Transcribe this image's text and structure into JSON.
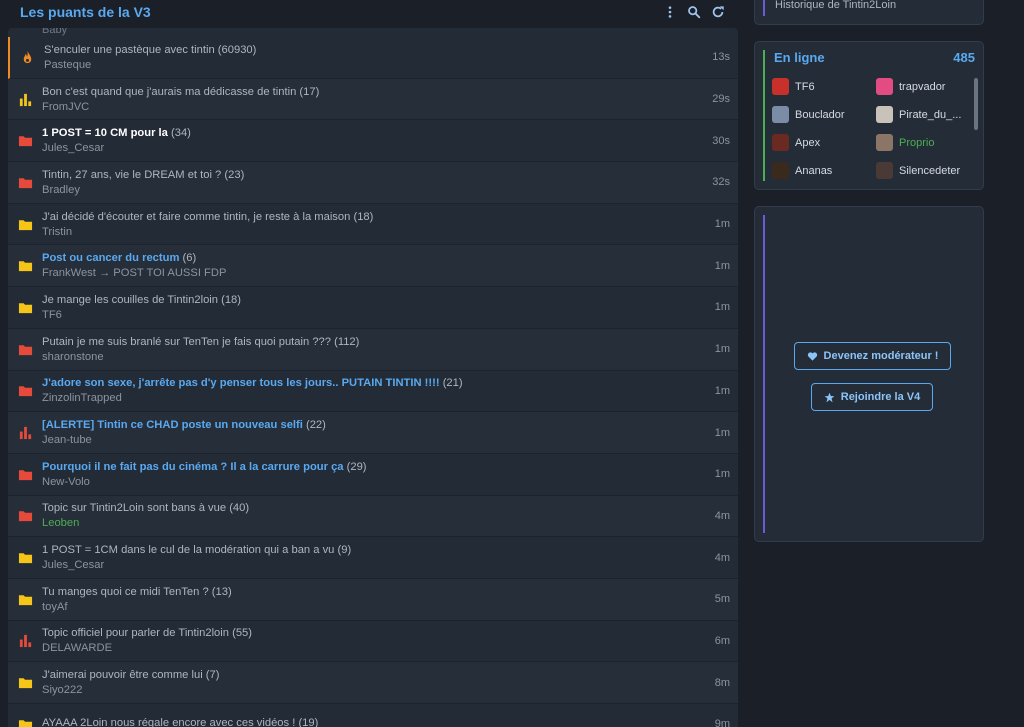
{
  "header": {
    "title": "Les puants de la V3"
  },
  "peek_text": "Baby",
  "topics": [
    {
      "icon": "fire",
      "color": "#f08a24",
      "title": "S'enculer une pastèque avec tintin",
      "count": "(60930)",
      "author": "Pasteque",
      "time": "13s",
      "style": "",
      "hot": true
    },
    {
      "icon": "chart",
      "color": "#f5c518",
      "title": "Bon c'est quand que j'aurais ma dédicasse de tintin",
      "count": "(17)",
      "author": "FromJVC",
      "time": "29s",
      "style": ""
    },
    {
      "icon": "folder",
      "color": "#e64a3b",
      "title": "1 POST = 10 CM pour la ",
      "count": "(34)",
      "author": "Jules_Cesar",
      "time": "30s",
      "style": "white"
    },
    {
      "icon": "folder",
      "color": "#e64a3b",
      "title": "Tintin, 27 ans, vie le DREAM et toi ?",
      "count": "(23)",
      "author": "Bradley",
      "time": "32s",
      "style": ""
    },
    {
      "icon": "folder",
      "color": "#f5c518",
      "title": "J'ai décidé d'écouter et faire comme tintin, je reste à la maison",
      "count": "(18)",
      "author": "Tristin",
      "time": "1m",
      "style": ""
    },
    {
      "icon": "folder",
      "color": "#f5c518",
      "title": "Post ou cancer du rectum",
      "count": "(6)",
      "author": "FrankWest → POST TOI AUSSI FDP",
      "time": "1m",
      "style": "blue"
    },
    {
      "icon": "folder",
      "color": "#f5c518",
      "title": "Je mange les couilles de Tintin2loin",
      "count": "(18)",
      "author": "TF6",
      "time": "1m",
      "style": ""
    },
    {
      "icon": "folder",
      "color": "#e64a3b",
      "title": "Putain je me suis branlé sur TenTen je fais quoi putain ???",
      "count": "(112)",
      "author": "sharonstone",
      "time": "1m",
      "style": ""
    },
    {
      "icon": "folder",
      "color": "#e64a3b",
      "title": "J'adore son sexe, j'arrête pas d'y penser tous les jours.. PUTAIN TINTIN !!!!",
      "count": " (21)",
      "author": "ZinzolinTrapped",
      "time": "1m",
      "style": "blue"
    },
    {
      "icon": "chart",
      "color": "#e64a3b",
      "title": "[ALERTE] Tintin ce CHAD poste un nouveau selfi",
      "count": "(22)",
      "author": "Jean-tube",
      "time": "1m",
      "style": "blue"
    },
    {
      "icon": "folder",
      "color": "#e64a3b",
      "title": "Pourquoi il ne fait pas du cinéma ? Il a la carrure pour ça",
      "count": "(29)",
      "author": "New-Volo",
      "time": "1m",
      "style": "blue"
    },
    {
      "icon": "folder",
      "color": "#e64a3b",
      "title": "Topic sur Tintin2Loin sont bans à vue",
      "count": "(40)",
      "author": "Leoben",
      "time": "4m",
      "style": "",
      "author_green": true
    },
    {
      "icon": "folder",
      "color": "#f5c518",
      "title": "1 POST = 1CM dans le cul de la modération qui a ban a vu",
      "count": "(9)",
      "author": "Jules_Cesar",
      "time": "4m",
      "style": ""
    },
    {
      "icon": "folder",
      "color": "#f5c518",
      "title": "Tu manges quoi ce midi TenTen ?",
      "count": "(13)",
      "author": "toyAf",
      "time": "5m",
      "style": ""
    },
    {
      "icon": "chart",
      "color": "#e64a3b",
      "title": "Topic officiel pour parler de Tintin2loin",
      "count": "(55)",
      "author": "DELAWARDE",
      "time": "6m",
      "style": ""
    },
    {
      "icon": "folder",
      "color": "#f5c518",
      "title": "J'aimerai pouvoir être comme lui ",
      "count": " (7)",
      "author": "Siyo222",
      "time": "8m",
      "style": ""
    },
    {
      "icon": "folder",
      "color": "#f5c518",
      "title": "AYAAA 2Loin nous régale encore avec ces vidéos !",
      "count": "(19)",
      "author": "",
      "time": "9m",
      "style": ""
    }
  ],
  "sidebar": {
    "top_text": "Historique de Tintin2Loin",
    "online": {
      "title": "En ligne",
      "count": "485",
      "users": [
        {
          "name": "TF6",
          "avatar": "#c8312b"
        },
        {
          "name": "trapvador",
          "avatar": "#e24c82"
        },
        {
          "name": "Bouclador",
          "avatar": "#7a8ca6"
        },
        {
          "name": "Pirate_du_...",
          "avatar": "#c9c2b8"
        },
        {
          "name": "Apex",
          "avatar": "#6a2a22"
        },
        {
          "name": "Proprio",
          "avatar": "#8a7566",
          "green": true
        },
        {
          "name": "Ananas",
          "avatar": "#3a2a1c"
        },
        {
          "name": "Silencedeter",
          "avatar": "#4a3a36"
        }
      ]
    },
    "moderator_button": "Devenez modérateur !",
    "join_button": "Rejoindre la V4"
  }
}
